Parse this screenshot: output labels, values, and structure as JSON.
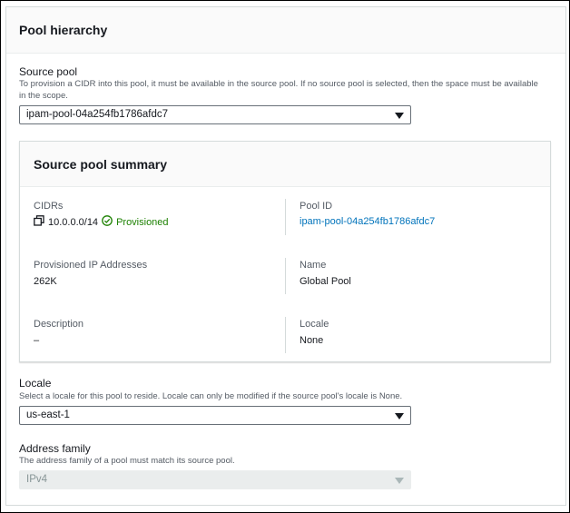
{
  "panel": {
    "title": "Pool hierarchy"
  },
  "source_pool": {
    "label": "Source pool",
    "description": "To provision a CIDR into this pool, it must be available in the source pool. If no source pool is selected, then the space must be available in the scope.",
    "value": "ipam-pool-04a254fb1786afdc7"
  },
  "summary": {
    "title": "Source pool summary",
    "cidrs_label": "CIDRs",
    "cidr_value": "10.0.0.0/14",
    "cidr_status": "Provisioned",
    "pool_id_label": "Pool ID",
    "pool_id_value": "ipam-pool-04a254fb1786afdc7",
    "provisioned_label": "Provisioned IP Addresses",
    "provisioned_value": "262K",
    "name_label": "Name",
    "name_value": "Global Pool",
    "description_label": "Description",
    "description_value": "–",
    "locale_label": "Locale",
    "locale_value": "None"
  },
  "locale": {
    "label": "Locale",
    "description": "Select a locale for this pool to reside. Locale can only be modified if the source pool's locale is None.",
    "value": "us-east-1"
  },
  "address_family": {
    "label": "Address family",
    "description": "The address family of a pool must match its source pool.",
    "value": "IPv4"
  },
  "icons": {
    "copy": "copy-icon",
    "status": "check-circle-icon",
    "caret": "caret-down-icon"
  },
  "colors": {
    "link": "#0073bb",
    "success": "#1d8102",
    "muted_text": "#545b64"
  }
}
